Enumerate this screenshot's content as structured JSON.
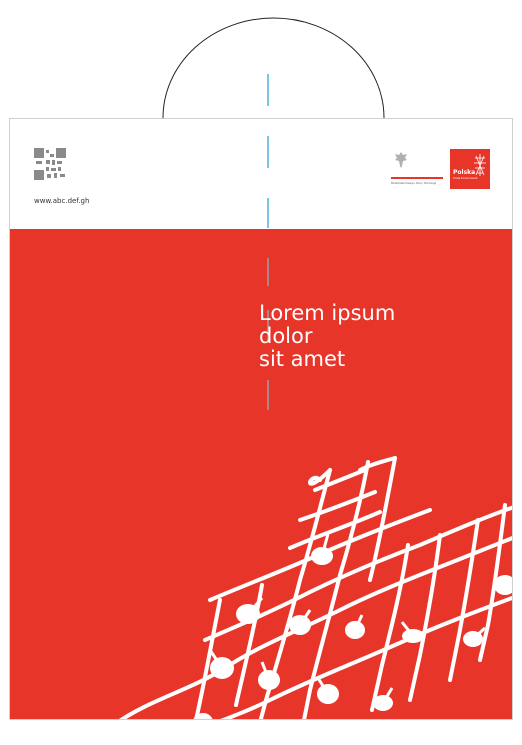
{
  "header": {
    "url": "www.abc.def.gh",
    "government_text": "Ministerstwo Rozwoju, Pracy i Technologii",
    "logo": {
      "title": "Polska",
      "subtitle": "Trade Environment"
    }
  },
  "headline": {
    "line1": "Lorem ipsum",
    "line2": "dolor",
    "line3": "sit amet"
  },
  "colors": {
    "brand_red": "#e8352a",
    "fold_line_blue": "#4fb3e0",
    "fold_line_gray": "#9aa0a8"
  },
  "icons": {
    "qr": "qr-code-icon",
    "eagle": "eagle-emblem-icon",
    "logo_mark": "polska-logo-mark-icon"
  }
}
